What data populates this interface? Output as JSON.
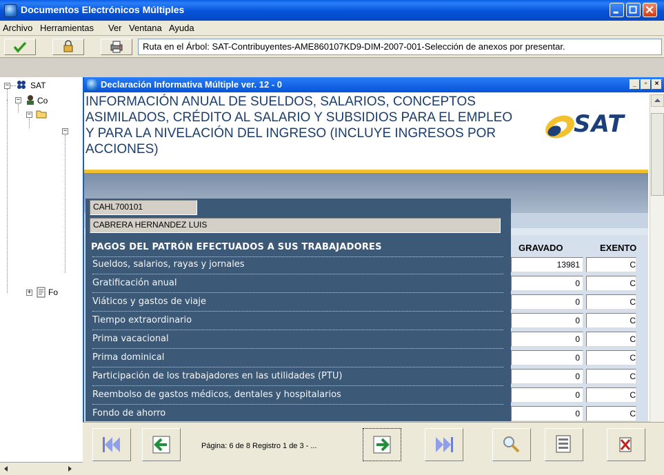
{
  "window": {
    "title": "Documentos Electrónicos Múltiples"
  },
  "menu": [
    "Archivo",
    "Herramientas",
    "Ver",
    "Ventana",
    "Ayuda"
  ],
  "toolbar": {
    "path": "Ruta en el Árbol: SAT-Contribuyentes-AME860107KD9-DIM-2007-001-Selección de anexos por presentar."
  },
  "tree": {
    "items": [
      "SAT",
      "Co",
      "Fo"
    ]
  },
  "inner": {
    "title": "Declaración Informativa Múltiple ver. 12 - 0",
    "heading_lines": [
      "INFORMACIÓN ANUAL DE SUELDOS, SALARIOS, CONCEPTOS",
      "ASIMILADOS, CRÉDITO AL SALARIO Y SUBSIDIOS PARA EL EMPLEO",
      "Y PARA LA NIVELACIÓN DEL INGRESO (INCLUYE INGRESOS POR",
      "ACCIONES)"
    ],
    "logo_text": "SAT"
  },
  "form": {
    "rfc": "CAHL700101",
    "name": "CABRERA HERNANDEZ LUIS",
    "section_title": "PAGOS DEL PATRÓN EFECTUADOS A SUS TRABAJADORES",
    "col_gravado": "GRAVADO",
    "col_exento": "EXENTO",
    "rows": [
      {
        "label": "Sueldos, salarios, rayas y jornales",
        "gravado": "13981",
        "exento": "C"
      },
      {
        "label": "Gratificación anual",
        "gravado": "0",
        "exento": "C"
      },
      {
        "label": "Viáticos y gastos de viaje",
        "gravado": "0",
        "exento": "C"
      },
      {
        "label": "Tiempo extraordinario",
        "gravado": "0",
        "exento": "C"
      },
      {
        "label": "Prima vacacional",
        "gravado": "0",
        "exento": "C"
      },
      {
        "label": "Prima dominical",
        "gravado": "0",
        "exento": "C"
      },
      {
        "label": "Participación de los trabajadores en las utilidades (PTU)",
        "gravado": "0",
        "exento": "C"
      },
      {
        "label": "Reembolso de gastos médicos, dentales y hospitalarios",
        "gravado": "0",
        "exento": "C"
      },
      {
        "label": "Fondo de ahorro",
        "gravado": "0",
        "exento": "C"
      }
    ]
  },
  "nav": {
    "page_info": "Página: 6  de  8 Registro  1 de  3 - ..."
  },
  "colors": {
    "title_blue": "#0553d8",
    "panel_blue": "#3c5a78",
    "heading_blue": "#1a3d6e",
    "gold": "#f2c12e"
  }
}
